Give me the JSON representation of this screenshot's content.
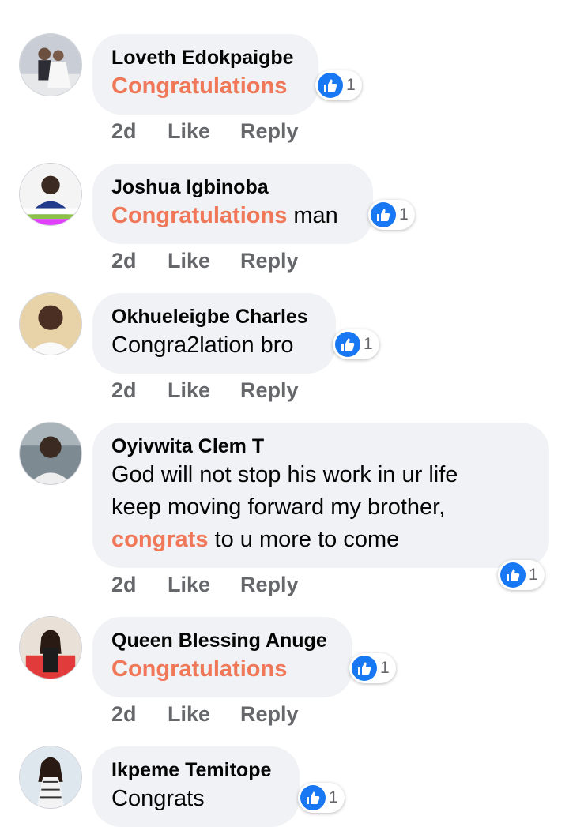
{
  "comments": [
    {
      "author": "Loveth Edokpaigbe",
      "highlight": "Congratulations",
      "text": "",
      "reactions": "1",
      "time": "2d",
      "like": "Like",
      "reply": "Reply"
    },
    {
      "author": "Joshua Igbinoba",
      "highlight": "Congratulations",
      "text": " man",
      "reactions": "1",
      "time": "2d",
      "like": "Like",
      "reply": "Reply"
    },
    {
      "author": "Okhueleigbe Charles",
      "text": "Congra2lation bro",
      "reactions": "1",
      "time": "2d",
      "like": "Like",
      "reply": "Reply"
    },
    {
      "author": "Oyivwita Clem T",
      "line1": "God will not stop his work in ur life",
      "line2": "keep moving forward my brother,",
      "highlight": "congrats",
      "line3": " to u more to come",
      "reactions": "1",
      "time": "2d",
      "like": "Like",
      "reply": "Reply"
    },
    {
      "author": "Queen Blessing Anuge",
      "highlight": "Congratulations",
      "reactions": "1",
      "time": "2d",
      "like": "Like",
      "reply": "Reply"
    },
    {
      "author": "Ikpeme Temitope",
      "text": "Congrats",
      "reactions": "1"
    }
  ],
  "colors": {
    "highlight": "#f07757",
    "bubble": "#f0f2f5",
    "like_blue": "#1877f2",
    "meta": "#65676b"
  }
}
